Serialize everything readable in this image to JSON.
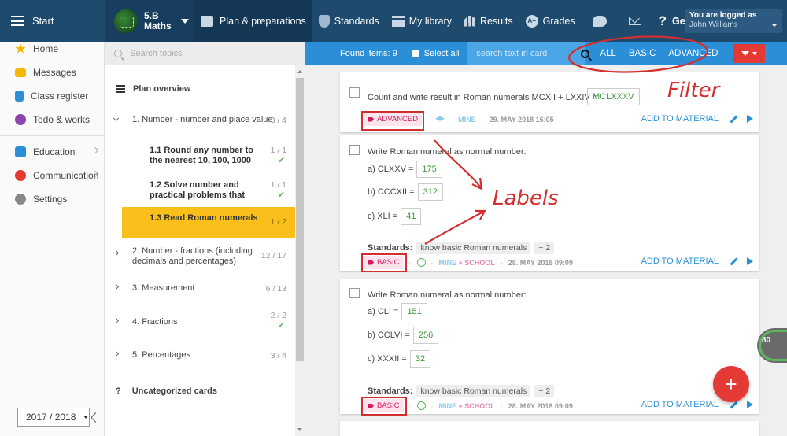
{
  "topbar": {
    "start_label": "Start",
    "class_line1": "5.B",
    "class_line2": "Maths",
    "nav": [
      {
        "label": "Plan & preparations",
        "icon": "briefcase-icon"
      },
      {
        "label": "Standards",
        "icon": "shield-icon"
      },
      {
        "label": "My library",
        "icon": "library-icon"
      },
      {
        "label": "Results",
        "icon": "bar-chart-icon"
      },
      {
        "label": "Grades",
        "icon": "grades-icon"
      }
    ],
    "help_label": "Get help",
    "user_line1": "You are logged as",
    "user_line2": "John Williams"
  },
  "sidebar": {
    "items": [
      {
        "label": "Home",
        "icon": "star-icon",
        "color": "#f5b700"
      },
      {
        "label": "Messages",
        "icon": "envelope-icon",
        "color": "#f5b700"
      },
      {
        "label": "Class register",
        "icon": "register-icon",
        "color": "#2a8fd6"
      },
      {
        "label": "Todo & works",
        "icon": "clock-icon",
        "color": "#8e44ad"
      },
      {
        "label": "Education",
        "icon": "education-icon",
        "color": "#2a8fd6"
      },
      {
        "label": "Communication",
        "icon": "chat-icon",
        "color": "#e53935"
      },
      {
        "label": "Settings",
        "icon": "gear-icon",
        "color": "#888888"
      }
    ],
    "year": "2017 / 2018"
  },
  "topics": {
    "search_placeholder": "Search topics",
    "overview_label": "Plan overview",
    "topic1": {
      "label": "1. Number - number and place value",
      "count": "3 / 4"
    },
    "sub1": {
      "label": "1.1 Round any number to the nearest 10, 100, 1000",
      "count": "1 / 1"
    },
    "sub2": {
      "label": "1.2 Solve number and practical problems that",
      "count": "1 / 1"
    },
    "sub3": {
      "label": "1.3 Read Roman numerals",
      "count": "1 / 2"
    },
    "topic2": {
      "label": "2. Number - fractions (including decimals and percentages)",
      "count": "12 / 17"
    },
    "topic3": {
      "label": "3. Measurement",
      "count": "6 / 13"
    },
    "topic4": {
      "label": "4. Fractions",
      "count": "2 / 2"
    },
    "topic5": {
      "label": "5. Percentages",
      "count": "3 / 4"
    },
    "uncat_label": "Uncategorized cards"
  },
  "filterbar": {
    "found": "Found items: 9",
    "select_all": "Select all",
    "search_placeholder": "search text in card",
    "filters": [
      "ALL",
      "BASIC",
      "ADVANCED"
    ]
  },
  "cards": [
    {
      "question": "Count and write result in Roman numerals MCXII + LXXIV =",
      "answer": "MCLXXXV",
      "tag": "ADVANCED",
      "owner": "MINE",
      "date": "29. MAY 2018 16:05",
      "action": "ADD TO MATERIAL"
    },
    {
      "question": "Write Roman numeral as normal number:",
      "rows": [
        {
          "label": "a) CLXXV =",
          "value": "175"
        },
        {
          "label": "b) CCCXII =",
          "value": "312"
        },
        {
          "label": "c) XLI =",
          "value": "41"
        }
      ],
      "standards_label": "Standards:",
      "standard_chip": "know basic Roman numerals",
      "standard_more": "+ 2",
      "tag": "BASIC",
      "owner_a": "MINE",
      "owner_b": "+ SCHOOL",
      "date": "28. MAY 2018 09:09",
      "action": "ADD TO MATERIAL"
    },
    {
      "question": "Write Roman numeral as normal number:",
      "rows": [
        {
          "label": "a) CLI =",
          "value": "151"
        },
        {
          "label": "b) CCLVI =",
          "value": "256"
        },
        {
          "label": "c) XXXII =",
          "value": "32"
        }
      ],
      "standards_label": "Standards:",
      "standard_chip": "know basic Roman numerals",
      "standard_more": "+ 2",
      "tag": "BASIC",
      "owner_a": "MINE",
      "owner_b": "+ SCHOOL",
      "date": "28. MAY 2018 09:09",
      "action": "ADD TO MATERIAL"
    }
  ],
  "annotations": {
    "filter": "Filter",
    "labels": "Labels"
  },
  "fab_label": "+",
  "progress_badge": "80",
  "colors": {
    "topbar": "#1e4a6e",
    "accent": "#2a8fd6",
    "selected": "#fbbf1c",
    "annotation": "#d32f2f"
  }
}
